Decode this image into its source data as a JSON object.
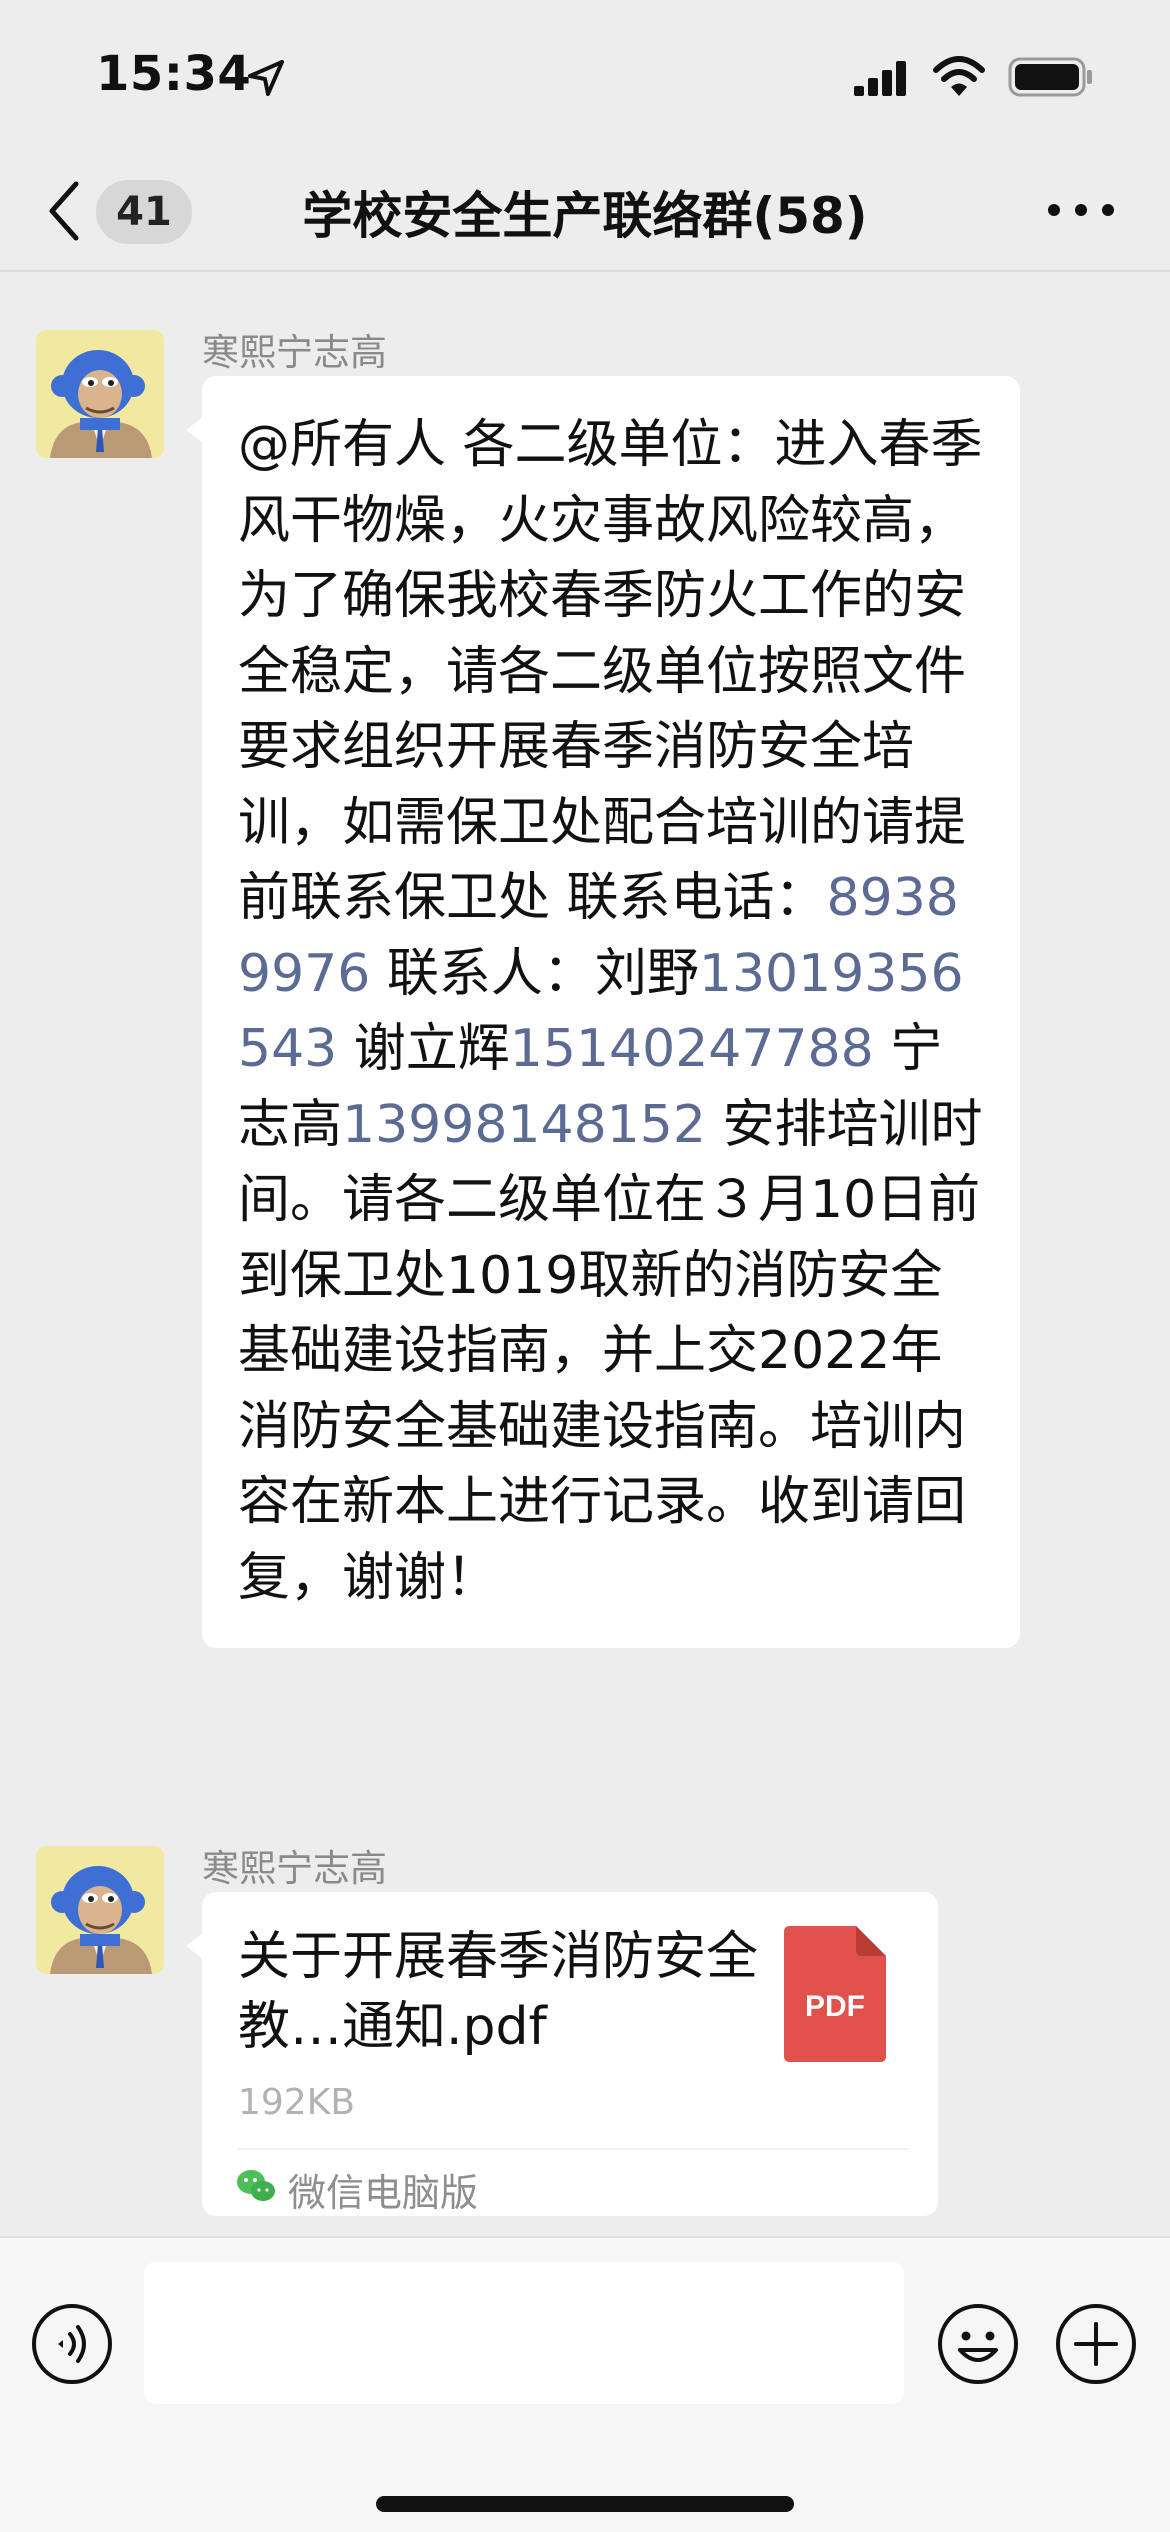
{
  "status_bar": {
    "time": "15:34",
    "icons": [
      "location-arrow-icon",
      "cellular-signal-icon",
      "wifi-icon",
      "battery-icon"
    ]
  },
  "nav": {
    "unread_count": "41",
    "title": "学校安全生产联络群(58)",
    "icons": [
      "back-chevron-icon",
      "more-icon"
    ]
  },
  "messages": [
    {
      "sender": "寒熙宁志高",
      "type": "text",
      "segments": [
        {
          "text": "@所有人 各二级单位：进入春季风干物燥，火灾事故风险较高，为了确保我校春季防火工作的安全稳定，请各二级单位按照文件要求组织开展春季消防安全培训，如需保卫处配合培训的请提前联系保卫处 联系电话："
        },
        {
          "text": "89389976",
          "link": true
        },
        {
          "text": " 联系人：刘野"
        },
        {
          "text": "13019356543",
          "link": true
        },
        {
          "text": " 谢立辉"
        },
        {
          "text": "15140247788",
          "link": true
        },
        {
          "text": " 宁志高"
        },
        {
          "text": "13998148152",
          "link": true
        },
        {
          "text": " 安排培训时间。请各二级单位在３月10日前到保卫处1019取新的消防安全基础建设指南，并上交2022年消防安全基础建设指南。培训内容在新本上进行记录。收到请回复，谢谢！"
        }
      ]
    },
    {
      "sender": "寒熙宁志高",
      "type": "file",
      "file_name": "关于开展春季消防安全教…通知.pdf",
      "file_size": "192KB",
      "file_badge": "PDF",
      "source": "微信电脑版"
    }
  ],
  "input_bar": {
    "placeholder": "",
    "icons": [
      "voice-icon",
      "emoji-icon",
      "plus-icon"
    ]
  },
  "colors": {
    "background": "#ededed",
    "bubble": "#ffffff",
    "link": "#5b6b93",
    "pdf_red": "#e0514b",
    "wechat_green": "#4cbf5a"
  }
}
